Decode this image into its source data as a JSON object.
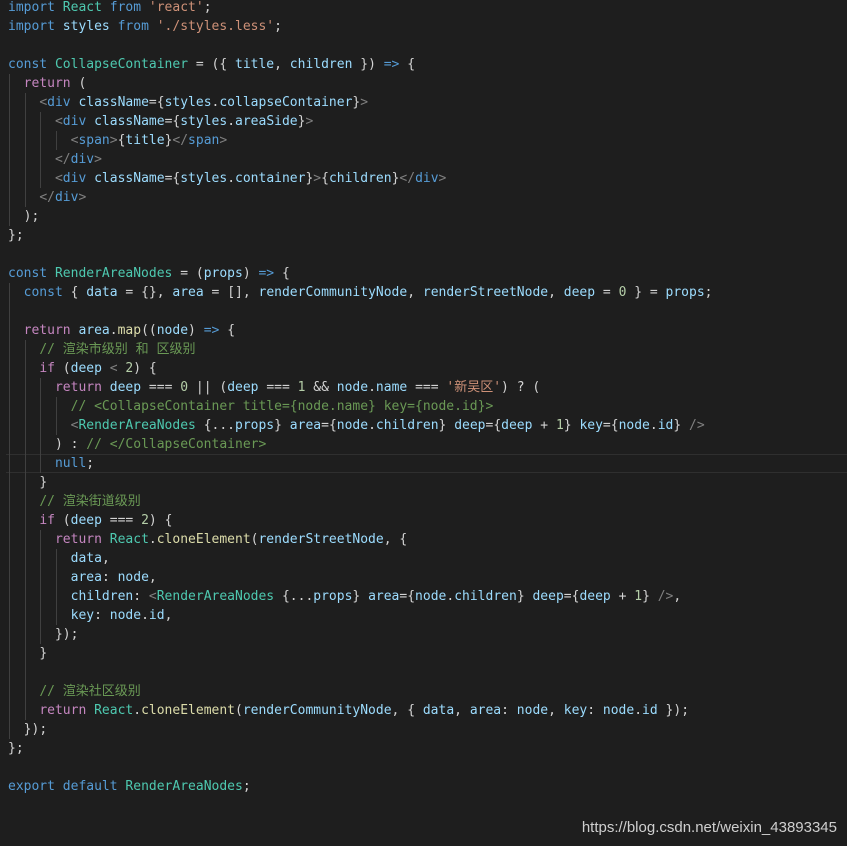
{
  "lines": [
    "import React from 'react';",
    "import styles from './styles.less';",
    "",
    "const CollapseContainer = ({ title, children }) => {",
    "  return (",
    "    <div className={styles.collapseContainer}>",
    "      <div className={styles.areaSide}>",
    "        <span>{title}</span>",
    "      </div>",
    "      <div className={styles.container}>{children}</div>",
    "    </div>",
    "  );",
    "};",
    "",
    "const RenderAreaNodes = (props) => {",
    "  const { data = {}, area = [], renderCommunityNode, renderStreetNode, deep = 0 } = props;",
    "",
    "  return area.map((node) => {",
    "    // 渲染市级别 和 区级别",
    "    if (deep < 2) {",
    "      return deep === 0 || (deep === 1 && node.name === '新吴区') ? (",
    "        // <CollapseContainer title={node.name} key={node.id}>",
    "        <RenderAreaNodes {...props} area={node.children} deep={deep + 1} key={node.id} />",
    "      ) : // </CollapseContainer>",
    "      null;",
    "    }",
    "    // 渲染街道级别",
    "    if (deep === 2) {",
    "      return React.cloneElement(renderStreetNode, {",
    "        data,",
    "        area: node,",
    "        children: <RenderAreaNodes {...props} area={node.children} deep={deep + 1} />,",
    "        key: node.id,",
    "      });",
    "    }",
    "",
    "    // 渲染社区级别",
    "    return React.cloneElement(renderCommunityNode, { data, area: node, key: node.id });",
    "  });",
    "};",
    "",
    "export default RenderAreaNodes;"
  ],
  "watermark": "https://blog.csdn.net/weixin_43893345",
  "colors": {
    "background": "#1e1e1e",
    "keyword": "#569cd6",
    "control": "#c586c0",
    "variable": "#9cdcfe",
    "function": "#dcdcaa",
    "string": "#ce9178",
    "number": "#b5cea8",
    "comment": "#6a9955",
    "type": "#4ec9b0"
  }
}
